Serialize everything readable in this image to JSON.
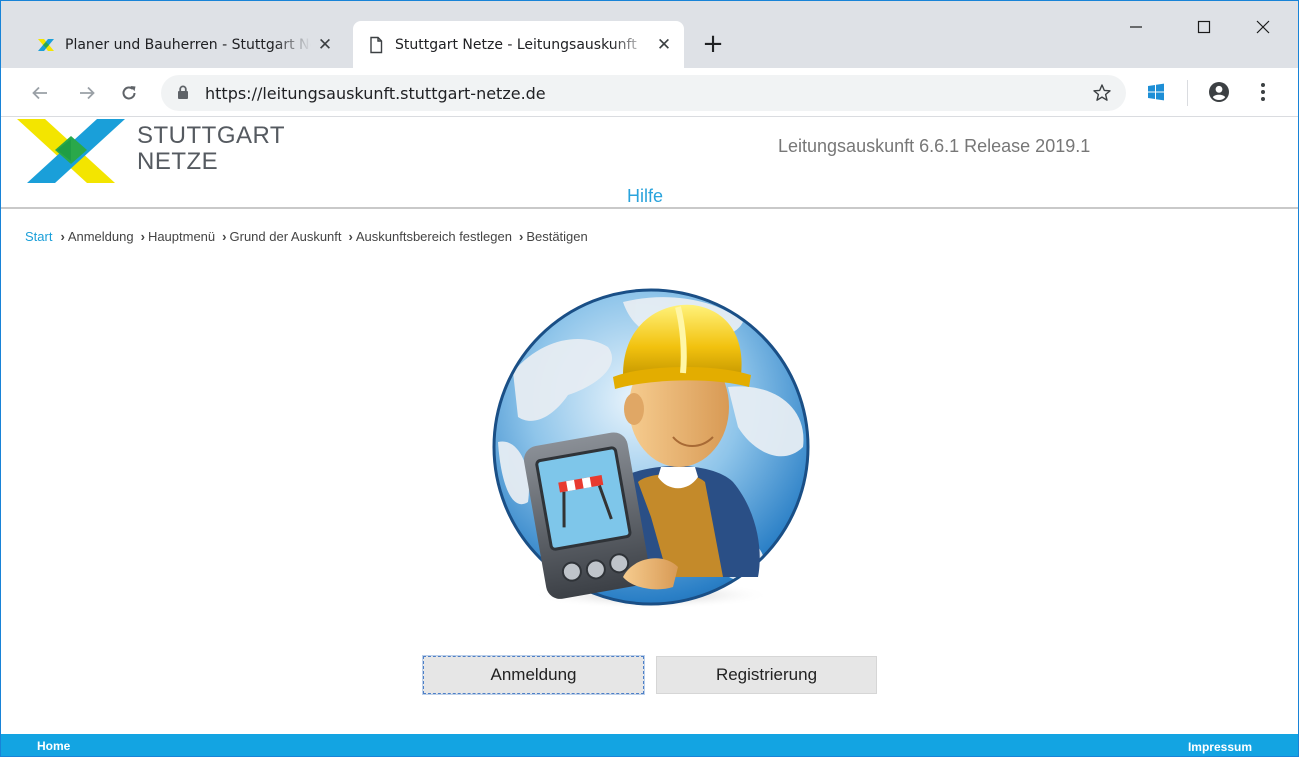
{
  "browser": {
    "tabs": [
      {
        "title": "Planer und Bauherren - Stuttgart Netze",
        "icon": "stuttgart-netze-favicon",
        "active": false
      },
      {
        "title": "Stuttgart Netze - Leitungsauskunft",
        "icon": "page-icon",
        "active": true
      }
    ],
    "new_tab_label": "+",
    "close_glyph": "✕",
    "url": "https://leitungsauskunft.stuttgart-netze.de",
    "toolbar_icons": [
      "back-icon",
      "forward-icon",
      "reload-icon",
      "lock-icon",
      "star-icon",
      "windows-icon",
      "profile-icon",
      "menu-icon"
    ],
    "window_controls": [
      "minimize-icon",
      "maximize-icon",
      "close-icon"
    ]
  },
  "header": {
    "logo_line1": "STUTTGART",
    "logo_line2": "NETZE",
    "version": "Leitungsauskunft 6.6.1 Release 2019.1",
    "help": "Hilfe"
  },
  "breadcrumb": {
    "start": "Start",
    "steps": [
      "Anmeldung",
      "Hauptmenü",
      "Grund der Auskunft",
      "Auskunftsbereich festlegen",
      "Bestätigen"
    ]
  },
  "actions": {
    "login": "Anmeldung",
    "register": "Registrierung"
  },
  "footer": {
    "home": "Home",
    "impressum": "Impressum"
  },
  "colors": {
    "accent_blue": "#13a4e2",
    "logo_yellow": "#f3e500",
    "logo_green": "#2aa84a",
    "logo_blue": "#1a9fd9",
    "button_gray": "#e6e6e6"
  }
}
